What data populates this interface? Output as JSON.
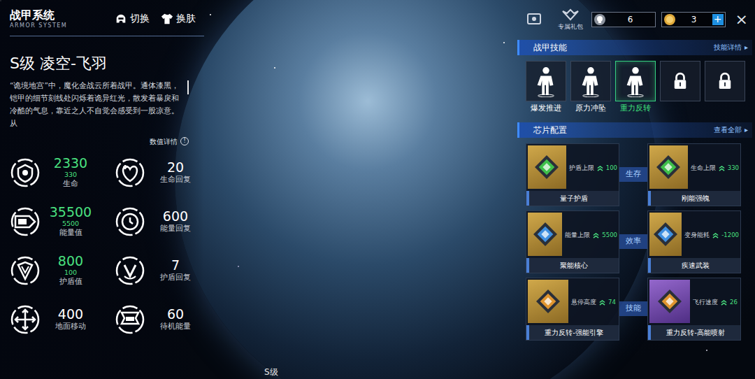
{
  "header": {
    "title": "战甲系统",
    "subtitle": "ARMOR SYSTEM",
    "buttons": [
      {
        "label": "切换"
      },
      {
        "label": "换肤"
      }
    ]
  },
  "armor": {
    "name": "S级 凌空-飞羽",
    "description": "“诡境地宫”中，魔化金战云所着战甲。通体漆黑，铠甲的细节刻线处闪烁着诡异红光，散发着暴戾和冷酷的气息，靠近之人不自觉会感受到一股凉意。从",
    "detail_link": "数值详情",
    "info_icon": "!"
  },
  "stats": [
    {
      "value": "2330",
      "bonus": "330",
      "label": "生命",
      "boosted": true
    },
    {
      "value": "20",
      "label": "生命回复",
      "boosted": false
    },
    {
      "value": "35500",
      "bonus": "5500",
      "label": "能量值",
      "boosted": true
    },
    {
      "value": "600",
      "label": "能量回复",
      "boosted": false
    },
    {
      "value": "800",
      "bonus": "100",
      "label": "护盾值",
      "boosted": true
    },
    {
      "value": "7",
      "label": "护盾回复",
      "boosted": false
    },
    {
      "value": "400",
      "label": "地面移动",
      "boosted": false
    },
    {
      "value": "60",
      "label": "待机能量",
      "boosted": false
    }
  ],
  "top_bar": {
    "gift_label": "专属礼包",
    "currencies": [
      {
        "amount": "6",
        "addable": false
      },
      {
        "amount": "3",
        "addable": true
      }
    ],
    "add_icon": "+",
    "close_icon": "×"
  },
  "skills": {
    "title": "战甲技能",
    "link": "技能详情",
    "link_arrow": "▸",
    "slots": [
      {
        "label": "爆发推进",
        "locked": false,
        "selected": false
      },
      {
        "label": "原力冲坠",
        "locked": false,
        "selected": false
      },
      {
        "label": "重力反转",
        "locked": false,
        "selected": true
      },
      {
        "locked": true,
        "selected": false
      },
      {
        "locked": true,
        "selected": false
      }
    ]
  },
  "chips": {
    "title": "芯片配置",
    "link": "查看全部",
    "link_arrow": "▸",
    "groups": [
      {
        "label": "生存",
        "items": [
          {
            "name": "量子护盾",
            "stat": "护盾上限",
            "value": "100",
            "color": "#3fbf4a",
            "rarity": "gold"
          },
          {
            "name": "刚能强魄",
            "stat": "生命上限",
            "value": "330",
            "color": "#3fbf4a",
            "rarity": "gold"
          }
        ]
      },
      {
        "label": "效率",
        "items": [
          {
            "name": "聚能核心",
            "stat": "能量上限",
            "value": "5500",
            "color": "#3f8fe0",
            "rarity": "gold"
          },
          {
            "name": "疾速武装",
            "stat": "变身能耗",
            "value": "-1200",
            "color": "#3f8fe0",
            "rarity": "gold"
          }
        ]
      },
      {
        "label": "技能",
        "items": [
          {
            "name": "重力反转-强能引擎",
            "stat": "悬停高度",
            "value": "74",
            "color": "#e0952f",
            "rarity": "gold"
          },
          {
            "name": "重力反转-高能喷射",
            "stat": "飞行速度",
            "value": "26",
            "color": "#e0952f",
            "rarity": "purple"
          }
        ]
      }
    ]
  },
  "bottom_label": "S级"
}
